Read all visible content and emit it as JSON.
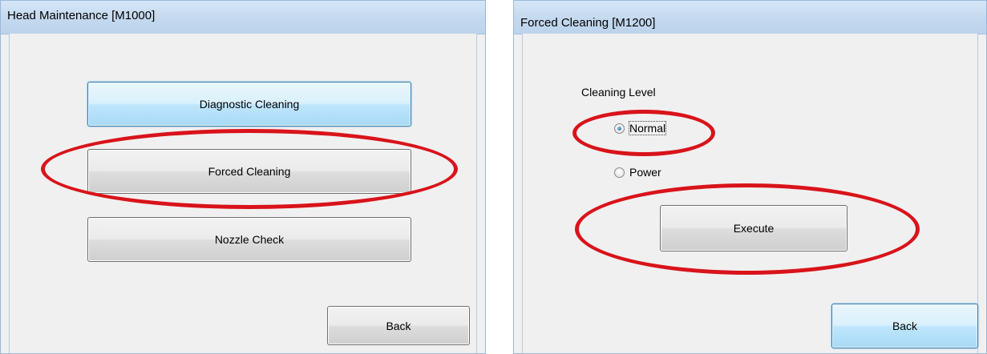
{
  "head_maintenance": {
    "title": "Head Maintenance [M1000]",
    "buttons": {
      "diagnostic_cleaning": "Diagnostic Cleaning",
      "forced_cleaning": "Forced Cleaning",
      "nozzle_check": "Nozzle Check",
      "back": "Back"
    }
  },
  "forced_cleaning": {
    "title": "Forced Cleaning [M1200]",
    "cleaning_level_label": "Cleaning Level",
    "options": {
      "normal": "Normal",
      "power": "Power"
    },
    "selected_option": "Normal",
    "buttons": {
      "execute": "Execute",
      "back": "Back"
    }
  },
  "highlight_color": "#d9131a"
}
